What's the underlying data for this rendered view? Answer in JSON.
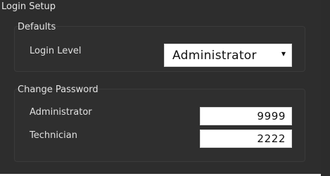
{
  "panel": {
    "title": "Login Setup"
  },
  "defaults": {
    "legend": "Defaults",
    "login_level_label": "Login Level",
    "login_level_value": "Administrator",
    "dropdown_arrow_glyph": "▼"
  },
  "change_password": {
    "legend": "Change Password",
    "administrator_label": "Administrator",
    "administrator_value": "9999",
    "technician_label": "Technician",
    "technician_value": "2222"
  },
  "colors": {
    "panel_background": "#2d2d2d",
    "group_background": "#2f2f2f",
    "text": "#e3e3e3",
    "input_background": "#ffffff"
  }
}
